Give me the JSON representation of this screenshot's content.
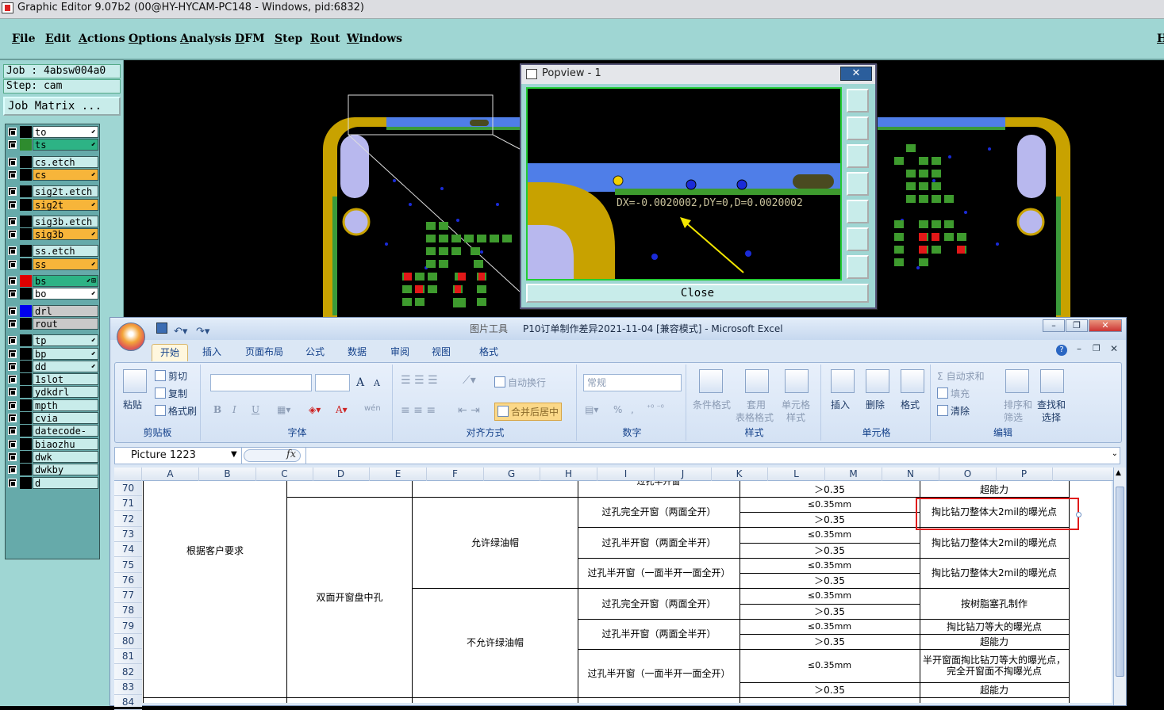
{
  "app": {
    "title": "Graphic Editor 9.07b2 (00@HY-HYCAM-PC148 - Windows, pid:6832)"
  },
  "menu": {
    "items": [
      "File",
      "Edit",
      "Actions",
      "Options",
      "Analysis",
      "DFM",
      "Step",
      "Rout",
      "Windows"
    ],
    "right_label": "H"
  },
  "job": {
    "job_label": "Job : 4absw004a0",
    "step_label": "Step: cam",
    "matrix_label": "Job Matrix ..."
  },
  "layers": [
    {
      "name": "to",
      "style": "on",
      "color": "#000000",
      "arrow": "⬋"
    },
    {
      "name": "ts",
      "style": "neg",
      "color": "#2e8b2e",
      "arrow": "⬋"
    },
    {
      "name": "cs.etch",
      "style": "normal",
      "color": "#000000",
      "arrow": ""
    },
    {
      "name": "cs",
      "style": "pos",
      "color": "#000000",
      "arrow": "⬋"
    },
    {
      "name": "sig2t.etch",
      "style": "normal",
      "color": "#000000",
      "arrow": ""
    },
    {
      "name": "sig2t",
      "style": "pos",
      "color": "#000000",
      "arrow": "⬋"
    },
    {
      "name": "sig3b.etch",
      "style": "normal",
      "color": "#000000",
      "arrow": ""
    },
    {
      "name": "sig3b",
      "style": "pos",
      "color": "#000000",
      "arrow": "⬋"
    },
    {
      "name": "ss.etch",
      "style": "normal",
      "color": "#000000",
      "arrow": ""
    },
    {
      "name": "ss",
      "style": "pos",
      "color": "#000000",
      "arrow": "⬋"
    },
    {
      "name": "bs",
      "style": "neg",
      "color": "#e00000",
      "arrow": "⬋⊞"
    },
    {
      "name": "bo",
      "style": "on",
      "color": "#000000",
      "arrow": "⬋"
    },
    {
      "name": "drl",
      "style": "gray",
      "color": "#0000ee",
      "arrow": ""
    },
    {
      "name": "rout",
      "style": "gray",
      "color": "#000000",
      "arrow": ""
    },
    {
      "name": "tp",
      "style": "normal",
      "color": "#000000",
      "arrow": "⬋"
    },
    {
      "name": "bp",
      "style": "normal",
      "color": "#000000",
      "arrow": "⬋"
    },
    {
      "name": "dd",
      "style": "normal",
      "color": "#000000",
      "arrow": "⬋"
    },
    {
      "name": "1slot",
      "style": "normal",
      "color": "#000000",
      "arrow": ""
    },
    {
      "name": "ydkdrl",
      "style": "normal",
      "color": "#000000",
      "arrow": ""
    },
    {
      "name": "mpth",
      "style": "normal",
      "color": "#000000",
      "arrow": ""
    },
    {
      "name": "cvia",
      "style": "normal",
      "color": "#000000",
      "arrow": ""
    },
    {
      "name": "datecode-to",
      "style": "normal",
      "color": "#000000",
      "arrow": ""
    },
    {
      "name": "biaozhu",
      "style": "normal",
      "color": "#000000",
      "arrow": ""
    },
    {
      "name": "dwk",
      "style": "normal",
      "color": "#000000",
      "arrow": ""
    },
    {
      "name": "dwkby",
      "style": "normal",
      "color": "#000000",
      "arrow": ""
    },
    {
      "name": "d",
      "style": "normal",
      "color": "#000000",
      "arrow": ""
    }
  ],
  "popview": {
    "title": "Popview - 1",
    "measure": "DX=-0.0020002,DY=0,D=0.0020002",
    "close_label": "Close",
    "x_label": "✕"
  },
  "excel": {
    "title": "P10订单制作差异2021-11-04  [兼容模式] - Microsoft Excel",
    "picture_tools": "图片工具",
    "tabs": [
      "开始",
      "插入",
      "页面布局",
      "公式",
      "数据",
      "审阅",
      "视图",
      "格式"
    ],
    "ribbon": {
      "paste": "粘贴",
      "cut": "剪切",
      "copy": "复制",
      "format_painter": "格式刷",
      "clipboard": "剪贴板",
      "font_group": "字体",
      "bold": "B",
      "italic": "I",
      "underline": "U",
      "grow": "A",
      "shrink": "A",
      "wen": "wén",
      "wrap": "自动换行",
      "merge": "合并后居中",
      "align_group": "对齐方式",
      "number_format": "常规",
      "percent": "%",
      "comma": ",",
      "number_group": "数字",
      "cond_format": "条件格式",
      "table_format": "套用",
      "table_format2": "表格格式",
      "cell_style": "单元格",
      "cell_style2": "样式",
      "style_group": "样式",
      "insert": "插入",
      "delete": "删除",
      "format": "格式",
      "cells_group": "单元格",
      "autosum": "自动求和",
      "fill": "填充",
      "clear": "清除",
      "sort": "排序和",
      "sort2": "筛选",
      "find": "查找和",
      "find2": "选择",
      "edit_group": "编辑"
    },
    "name_box": "Picture 1223",
    "fx": "fx",
    "columns": [
      "A",
      "B",
      "C",
      "D",
      "E",
      "F",
      "G",
      "H",
      "I",
      "J",
      "K",
      "L",
      "M",
      "N",
      "O",
      "P"
    ],
    "rows": [
      "70",
      "71",
      "72",
      "73",
      "74",
      "75",
      "76",
      "77",
      "78",
      "79",
      "80",
      "81",
      "82",
      "83",
      "84"
    ],
    "cells": {
      "top_partial": "过孔半开窗",
      "customer": "根据客户要求",
      "double_side": "双面开窗盘中孔",
      "allow_oil": "允许绿油帽",
      "no_oil": "不允许绿油帽",
      "full_open": "过孔完全开窗（两面全开）",
      "half_open": "过孔半开窗（两面全半开）",
      "half_one": "过孔半开窗（一面半开一面全开）",
      "full_open2": "过孔完全开窗（两面全开）",
      "half_open2": "过孔半开窗（两面全半开）",
      "half_one2": "过孔半开窗（一面半开一面全开）",
      "gt035": "＞0.35",
      "le035": "≤0.35mm",
      "over": "超能力",
      "expose2mil": "掏比钻刀整体大2mil的曝光点",
      "resin": "按树脂塞孔制作",
      "expose_eq": "掏比钻刀等大的曝光点",
      "half_note": "半开窗面掏比钻刀等大的曝光点，完全开窗面不掏曝光点"
    }
  }
}
